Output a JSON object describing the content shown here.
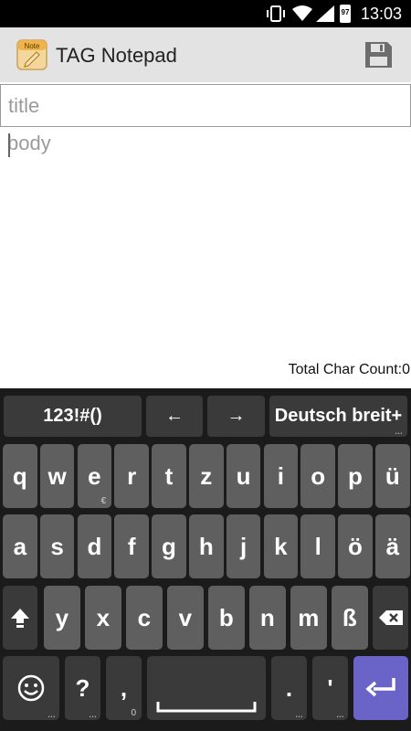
{
  "status_bar": {
    "time": "13:03",
    "battery_level": "97",
    "icons": [
      "vibrate-icon",
      "wifi-icon",
      "signal-icon",
      "battery-icon"
    ]
  },
  "app": {
    "title": "TAG Notepad",
    "logo_text": "Note",
    "save_icon": "save-icon"
  },
  "editor": {
    "title_placeholder": "title",
    "body_placeholder": "body",
    "char_count_label": "Total Char Count:0"
  },
  "keyboard": {
    "top_row": {
      "symbols": "123!#()",
      "left_arrow": "←",
      "right_arrow": "→",
      "layout": "Deutsch breit+"
    },
    "row1": [
      "q",
      "w",
      "e",
      "r",
      "t",
      "z",
      "u",
      "i",
      "o",
      "p",
      "ü"
    ],
    "row1_sub": {
      "e": "€"
    },
    "row2": [
      "a",
      "s",
      "d",
      "f",
      "g",
      "h",
      "j",
      "k",
      "l",
      "ö",
      "ä"
    ],
    "row3": [
      "y",
      "x",
      "c",
      "v",
      "b",
      "n",
      "m",
      "ß"
    ],
    "row4": {
      "question": "?",
      "comma": ",",
      "comma_sub": "0",
      "period": ".",
      "apostrophe": "'"
    },
    "colors": {
      "enter_key": "#6a64c8",
      "key": "#5f5f5f",
      "key_dark": "#3a3a3a",
      "background": "#1b1b1b"
    }
  }
}
